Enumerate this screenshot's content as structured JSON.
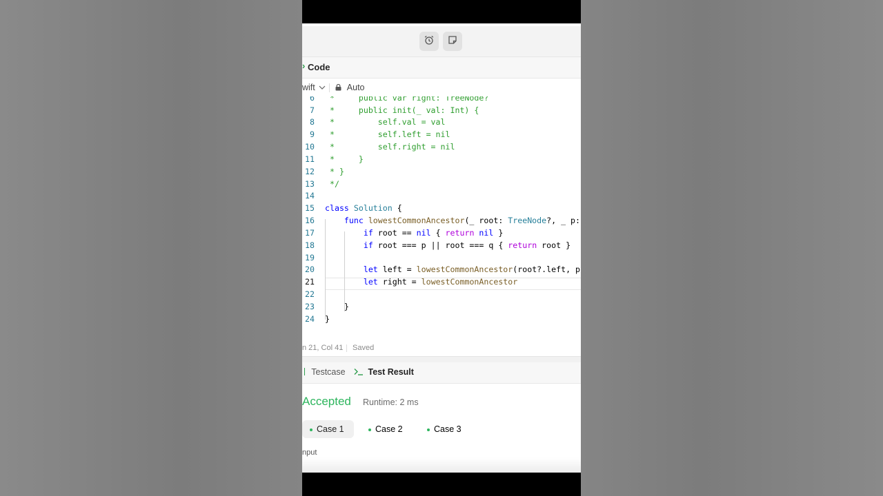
{
  "header": {
    "title": "Code",
    "language": "wift",
    "autosave": "Auto"
  },
  "editor": {
    "lines": [
      {
        "n": "6",
        "text": " *     public var right: TreeNode?"
      },
      {
        "n": "7",
        "text": " *     public init(_ val: Int) {"
      },
      {
        "n": "8",
        "text": " *         self.val = val"
      },
      {
        "n": "9",
        "text": " *         self.left = nil"
      },
      {
        "n": "10",
        "text": " *         self.right = nil"
      },
      {
        "n": "11",
        "text": " *     }"
      },
      {
        "n": "12",
        "text": " * }"
      },
      {
        "n": "13",
        "text": " */"
      },
      {
        "n": "14",
        "text": ""
      },
      {
        "n": "15",
        "text": "class Solution {"
      },
      {
        "n": "16",
        "text": "    func lowestCommonAncestor(_ root: TreeNode?, _ p:"
      },
      {
        "n": "17",
        "text": "        if root == nil { return nil }"
      },
      {
        "n": "18",
        "text": "        if root === p || root === q { return root }"
      },
      {
        "n": "19",
        "text": ""
      },
      {
        "n": "20",
        "text": "        let left = lowestCommonAncestor(root?.left, p,"
      },
      {
        "n": "21",
        "text": "        let right = lowestCommonAncestor"
      },
      {
        "n": "22",
        "text": ""
      },
      {
        "n": "23",
        "text": "    }"
      },
      {
        "n": "24",
        "text": "}"
      }
    ],
    "active_line": "21"
  },
  "status": {
    "position": "n 21, Col 41",
    "saved": "Saved"
  },
  "tabs": {
    "testcase": "Testcase",
    "test_result": "Test Result"
  },
  "result": {
    "verdict": "Accepted",
    "runtime": "Runtime: 2 ms",
    "cases": [
      "Case 1",
      "Case 2",
      "Case 3"
    ],
    "input_label": "nput"
  },
  "colors": {
    "accepted": "#2db55d",
    "comment": "#2f9e2f",
    "line_number": "#237893"
  }
}
